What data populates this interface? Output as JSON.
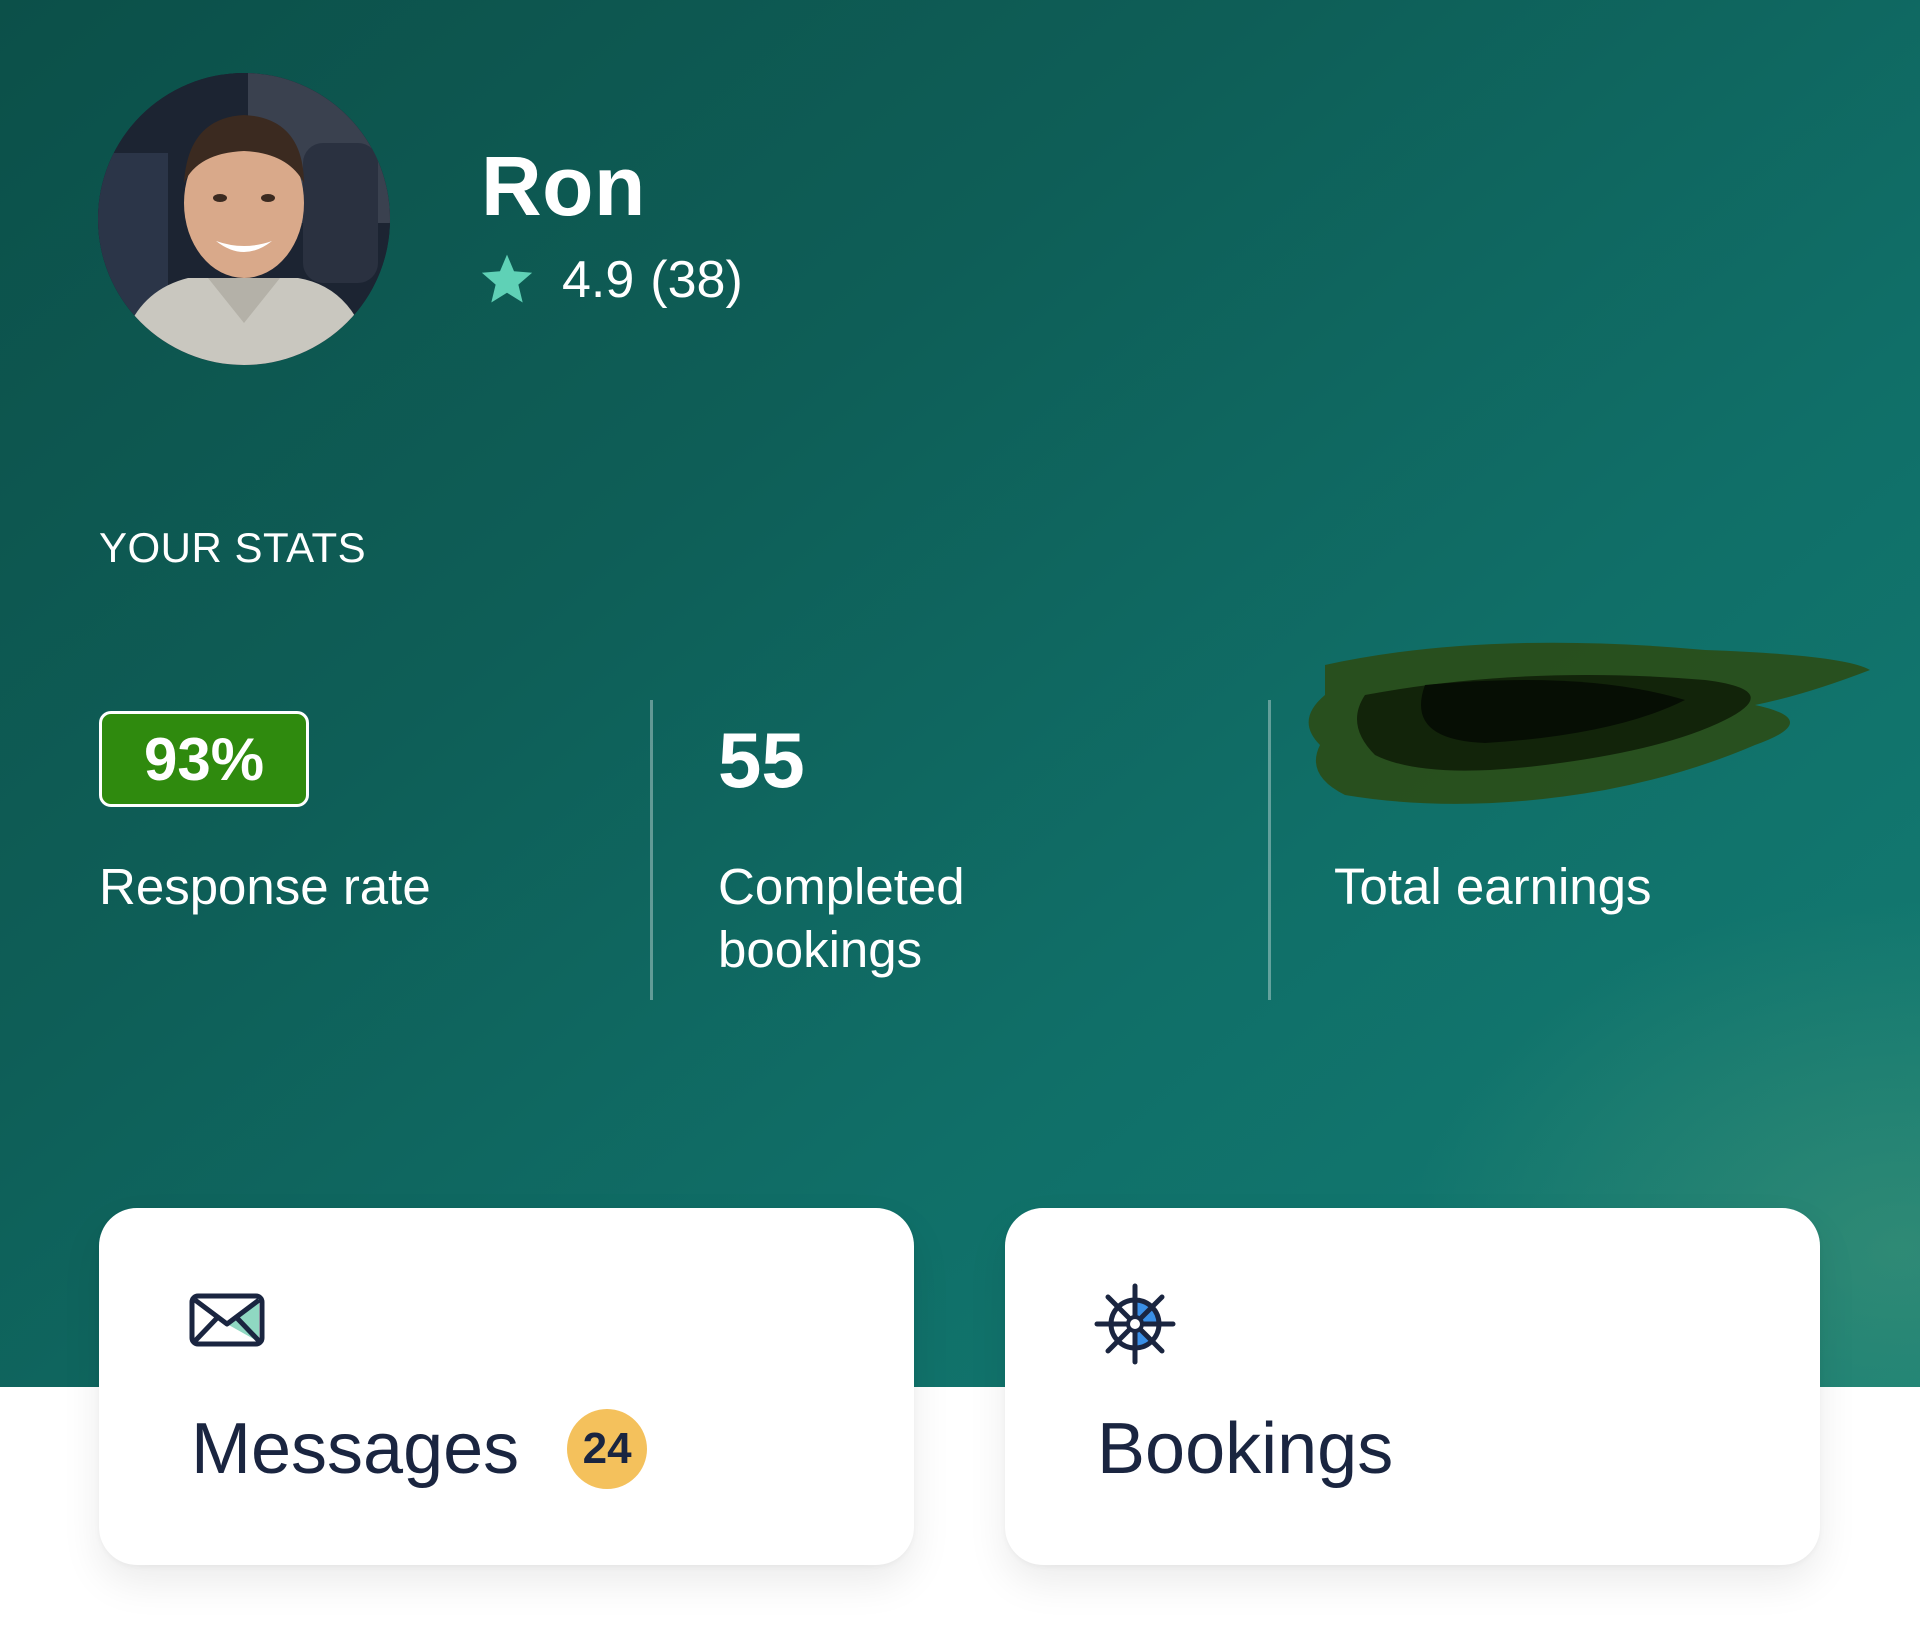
{
  "profile": {
    "name": "Ron",
    "rating": "4.9",
    "review_count": "(38)",
    "avatar_icon": "avatar-photo",
    "star_icon": "star-icon"
  },
  "stats": {
    "title": "YOUR STATS",
    "response_rate": {
      "value": "93%",
      "label": "Response rate"
    },
    "completed_bookings": {
      "value": "55",
      "label": "Completed bookings"
    },
    "total_earnings": {
      "label": "Total earnings"
    }
  },
  "cards": {
    "messages": {
      "label": "Messages",
      "count": "24",
      "icon": "envelope-icon"
    },
    "bookings": {
      "label": "Bookings",
      "icon": "ship-wheel-icon"
    }
  },
  "colors": {
    "hero_dark": "#0c5049",
    "hero_light": "#137d74",
    "badge_green": "#2f8a0e",
    "star_teal": "#5fd1b6",
    "count_badge": "#f4c15c",
    "card_text": "#1a2540"
  }
}
